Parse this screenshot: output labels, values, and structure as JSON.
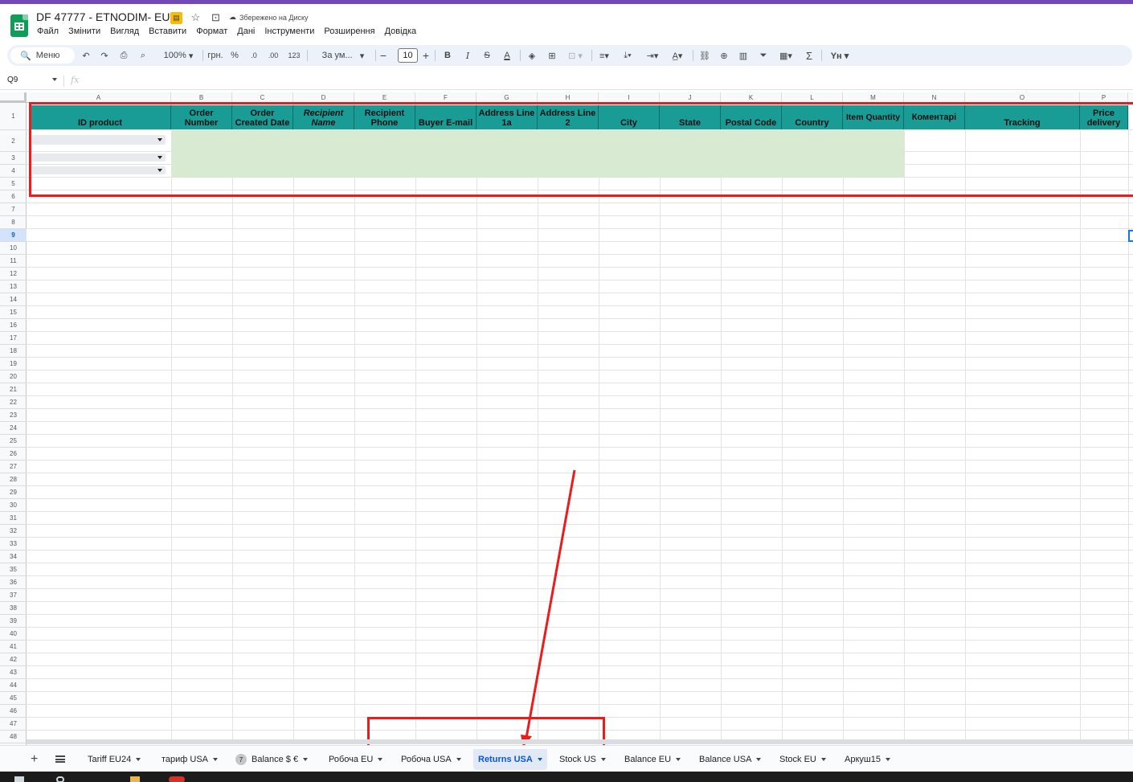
{
  "app": {
    "doc_title": "DF 47777 - ETNODIM- EU",
    "saved_status": "Збережено на Диску"
  },
  "menu": [
    "Файл",
    "Змінити",
    "Вигляд",
    "Вставити",
    "Формат",
    "Дані",
    "Інструменти",
    "Розширення",
    "Довідка"
  ],
  "toolbar": {
    "search_label": "Меню",
    "zoom": "100%",
    "currency": "грн.",
    "percent": "%",
    "dec_decrease": ".0",
    "dec_increase": ".00",
    "number_format": "123",
    "font": "За ум...",
    "font_size": "10",
    "bold": "B",
    "italic": "I",
    "strike": "S",
    "text_color": "A",
    "sum": "Σ"
  },
  "formula_bar": {
    "cell_ref": "Q9",
    "fx": "fx"
  },
  "columns": [
    "A",
    "B",
    "C",
    "D",
    "E",
    "F",
    "G",
    "H",
    "I",
    "J",
    "K",
    "L",
    "M",
    "N",
    "O",
    "P"
  ],
  "rows": [
    "1",
    "2",
    "3",
    "4",
    "5",
    "6",
    "7",
    "8",
    "9",
    "10",
    "11",
    "12",
    "13",
    "14",
    "15",
    "16",
    "17",
    "18",
    "19",
    "20",
    "21",
    "22",
    "23",
    "24",
    "25",
    "26",
    "27",
    "28",
    "29",
    "30",
    "31",
    "32",
    "33",
    "34",
    "35",
    "36",
    "37",
    "38",
    "39",
    "40",
    "41",
    "42",
    "43",
    "44",
    "45",
    "46",
    "47",
    "48"
  ],
  "headers": [
    [
      "ID product"
    ],
    [
      "Order",
      "Number"
    ],
    [
      "Order",
      "Created Date"
    ],
    [
      "Recipient",
      "Name"
    ],
    [
      "Recipient",
      "Phone"
    ],
    [
      "Buyer E-mail"
    ],
    [
      "Address Line",
      "1a"
    ],
    [
      "Address Line",
      "2"
    ],
    [
      "City"
    ],
    [
      "State"
    ],
    [
      "Postal Code"
    ],
    [
      "Country"
    ],
    [
      "Item Quantity"
    ],
    [
      "Коментарі"
    ],
    [
      "Tracking"
    ],
    [
      "Price",
      "delivery"
    ]
  ],
  "tabs": [
    {
      "label": "Tariff EU24",
      "active": false
    },
    {
      "label": "тариф USA",
      "active": false
    },
    {
      "label": "Balance $ €",
      "active": false,
      "badge": "7"
    },
    {
      "label": "Робоча EU",
      "active": false
    },
    {
      "label": "Робоча USA",
      "active": false
    },
    {
      "label": "Returns USA",
      "active": true
    },
    {
      "label": "Stock US",
      "active": false
    },
    {
      "label": "Balance EU",
      "active": false
    },
    {
      "label": "Balance USA",
      "active": false
    },
    {
      "label": "Stock EU",
      "active": false
    },
    {
      "label": "Аркуш15",
      "active": false
    }
  ],
  "colors": {
    "header_fill": "#199c95",
    "input_fill": "#d9ead3",
    "annotation": "#ea1c1c",
    "accent": "#0b57d0"
  }
}
